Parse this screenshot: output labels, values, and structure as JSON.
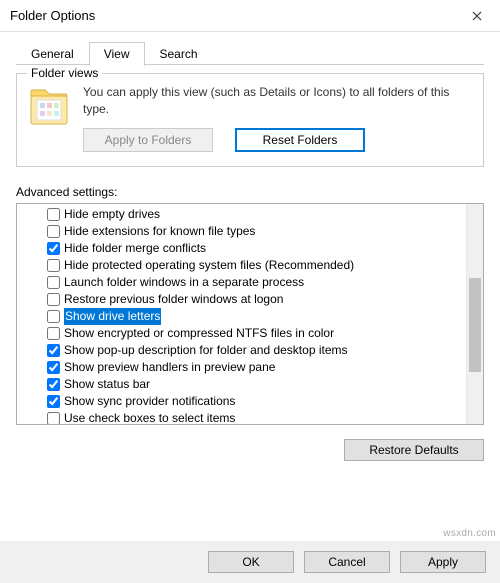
{
  "window": {
    "title": "Folder Options"
  },
  "tabs": {
    "general": "General",
    "view": "View",
    "search": "Search"
  },
  "folderViews": {
    "title": "Folder views",
    "desc": "You can apply this view (such as Details or Icons) to all folders of this type.",
    "applyBtn": "Apply to Folders",
    "resetBtn": "Reset Folders"
  },
  "advanced": {
    "label": "Advanced settings:",
    "items": {
      "0": "Hide empty drives",
      "1": "Hide extensions for known file types",
      "2": "Hide folder merge conflicts",
      "3": "Hide protected operating system files (Recommended)",
      "4": "Launch folder windows in a separate process",
      "5": "Restore previous folder windows at logon",
      "6": "Show drive letters",
      "7": "Show encrypted or compressed NTFS files in color",
      "8": "Show pop-up description for folder and desktop items",
      "9": "Show preview handlers in preview pane",
      "10": "Show status bar",
      "11": "Show sync provider notifications",
      "12": "Use check boxes to select items"
    },
    "checked": {
      "2": true,
      "8": true,
      "9": true,
      "10": true,
      "11": true
    }
  },
  "restoreDefaults": "Restore Defaults",
  "footer": {
    "ok": "OK",
    "cancel": "Cancel",
    "apply": "Apply"
  },
  "watermark": "wsxdn.com"
}
